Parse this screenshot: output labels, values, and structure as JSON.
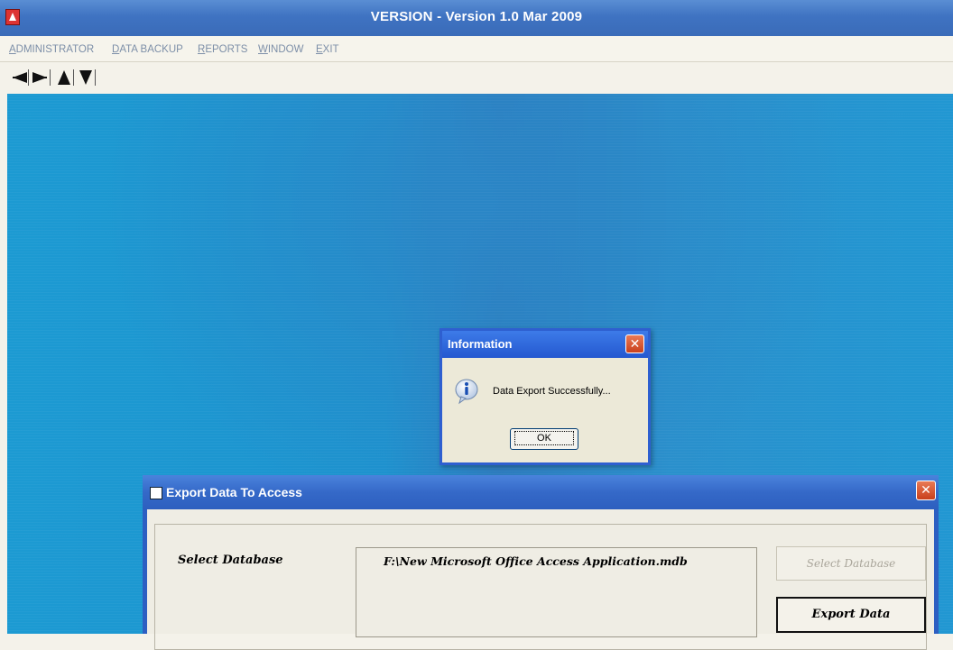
{
  "window": {
    "title": "VERSION  -  Version 1.0 Mar 2009"
  },
  "menu": [
    {
      "label": "ADMINISTRATOR",
      "key": "A",
      "rest": "DMINISTRATOR"
    },
    {
      "label": "DATA BACKUP",
      "key": "D",
      "rest": "ATA BACKUP"
    },
    {
      "label": "REPORTS",
      "key": "R",
      "rest": "EPORTS"
    },
    {
      "label": "WINDOW",
      "key": "W",
      "rest": "INDOW"
    },
    {
      "label": "EXIT",
      "key": "E",
      "rest": "XIT"
    }
  ],
  "toolbar": {
    "buttons": [
      "arrow-left-icon",
      "arrow-right-icon",
      "arrow-up-icon",
      "arrow-down-icon"
    ]
  },
  "info_dialog": {
    "title": "Information",
    "message": "Data Export Successfully...",
    "ok_label": "OK",
    "close_glyph": "✕"
  },
  "export_window": {
    "title": "Export Data To Access",
    "close_glyph": "✕",
    "select_db_label": "Select Database",
    "db_path": "F:\\New Microsoft Office Access Application.mdb",
    "select_db_button": "Select Database",
    "export_button": "Export Data"
  },
  "colors": {
    "title_bar": "#3f73c2",
    "desktop": "#1c93cf",
    "dialog_title": "#2458d0",
    "close_button": "#c9401c"
  }
}
